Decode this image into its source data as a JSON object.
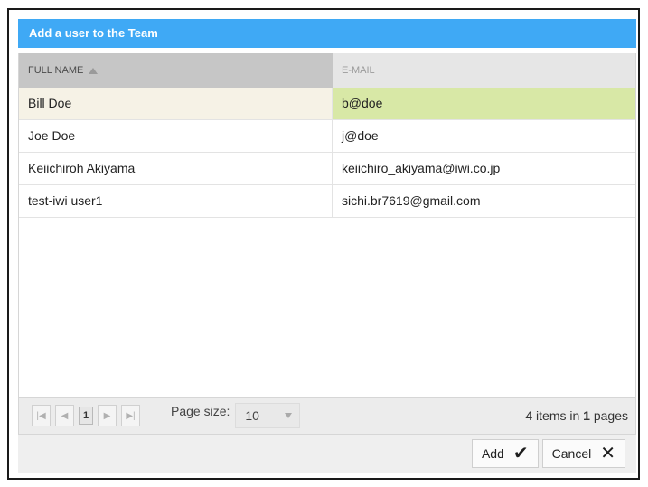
{
  "dialog": {
    "title": "Add a user to the Team"
  },
  "grid": {
    "columns": [
      {
        "label": "FULL NAME",
        "sort": "ascending"
      },
      {
        "label": "E-MAIL"
      }
    ],
    "rows": [
      {
        "name": "Bill Doe",
        "email": "b@doe",
        "selected": true
      },
      {
        "name": "Joe Doe",
        "email": "j@doe",
        "selected": false
      },
      {
        "name": "Keiichiroh Akiyama",
        "email": "keiichiro_akiyama@iwi.co.jp",
        "selected": false
      },
      {
        "name": "test-iwi user1",
        "email": "sichi.br7619@gmail.com",
        "selected": false
      }
    ]
  },
  "pager": {
    "current_page": "1",
    "page_size_label": "Page size:",
    "page_size_value": "10",
    "info_count": "4",
    "info_middle": " items in ",
    "info_pages": "1",
    "info_suffix": " pages"
  },
  "footer": {
    "add_label": "Add",
    "cancel_label": "Cancel"
  },
  "colors": {
    "titlebar": "#3fa9f5",
    "selected_row_email_bg": "#d8e8a6",
    "selected_row_name_bg": "#f6f2e6"
  },
  "icons": [
    "sort-ascending-icon",
    "first-page-icon",
    "prev-page-icon",
    "next-page-icon",
    "last-page-icon",
    "dropdown-arrow-icon",
    "checkmark-icon",
    "close-icon"
  ]
}
